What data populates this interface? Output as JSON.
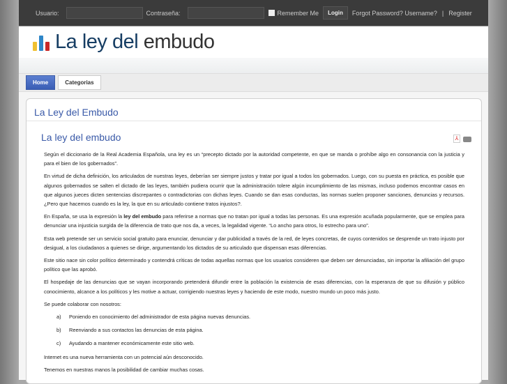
{
  "topbar": {
    "user_label": "Usuario:",
    "pass_label": "Contraseña:",
    "remember": "Remember Me",
    "login": "Login",
    "forgot": "Forgot Password? Username?",
    "sep": "|",
    "register": "Register"
  },
  "logo": {
    "part1": "La ley del",
    "part2": "embudo",
    "colors": [
      "#f0c030",
      "#2e86c8",
      "#c82828"
    ]
  },
  "nav": [
    {
      "label": "Home"
    },
    {
      "label": "Categorias"
    }
  ],
  "page_title": "La Ley del Embudo",
  "article": {
    "title": "La ley del embudo",
    "pdf_icon": "pdf-icon",
    "print_icon": "print-icon",
    "p1": "Según el diccionario de la Real Academia Española, una ley es un “precepto dictado por la autoridad competente, en que se manda o prohíbe algo en consonancia con la justicia y para el bien de los gobernados”.",
    "p2": "En virtud de dicha definición, los articulados de nuestras leyes, deberían ser siempre justos y tratar por igual a todos los gobernados. Luego, con su puesta en práctica, es posible que algunos gobernados se salten el dictado de las leyes, también pudiera ocurrir que la administración tolere algún incumplimiento de las mismas, incluso podemos encontrar casos en que algunos jueces dicten sentencias discrepantes o contradictorias con dichas leyes. Cuando se dan esas conductas, las normas suelen proponer sanciones, denuncias y recursos. ¿Pero que hacemos cuando es la ley, la que en su articulado contiene tratos injustos?.",
    "p3a": "En España, se usa la expresión la ",
    "p3b": "ley del embudo",
    "p3c": " para referirse a normas que no tratan por igual a todas las personas. Es una expresión acuñada popularmente, que se emplea para denunciar una injusticia surgida de la diferencia de trato que nos da, a veces, la legalidad vigente. “Lo ancho para otros, lo estrecho para uno”.",
    "p4": "Esta web pretende ser un servicio social gratuito para enunciar, denunciar y dar publicidad a través de la red, de leyes concretas, de cuyos contenidos se desprende un trato injusto por desigual, a los ciudadanos a quienes se dirige, argumentando los dictados de su articulado que dispensan esas diferencias.",
    "p5": "Este sitio nace sin color político determinado y contendrá críticas de todas aquellas normas que los usuarios consideren que deben ser denunciadas, sin importar la afiliación del grupo político que las aprobó.",
    "p6": "El hospedaje de las denuncias que se vayan incorporando pretenderá difundir entre la población la existencia de esas diferencias, con la esperanza de que su difusión y público conocimiento, alcance a los políticos y les motive a actuar, corrigiendo nuestras leyes y haciendo de este modo, nuestro mundo un poco más justo.",
    "p7": "Se puede colaborar con nosotros:",
    "list": [
      {
        "m": "a)",
        "t": "Poniendo en conocimiento del administrador de esta página nuevas denuncias."
      },
      {
        "m": "b)",
        "t": "Reenviando a sus contactos las denuncias de esta página."
      },
      {
        "m": "c)",
        "t": "Ayudando a mantener económicamente este sitio web."
      }
    ],
    "p8": "Internet es una nueva herramienta con un potencial aún desconocido.",
    "p9": "Tenemos en nuestras manos la posibilidad de cambiar muchas cosas."
  }
}
